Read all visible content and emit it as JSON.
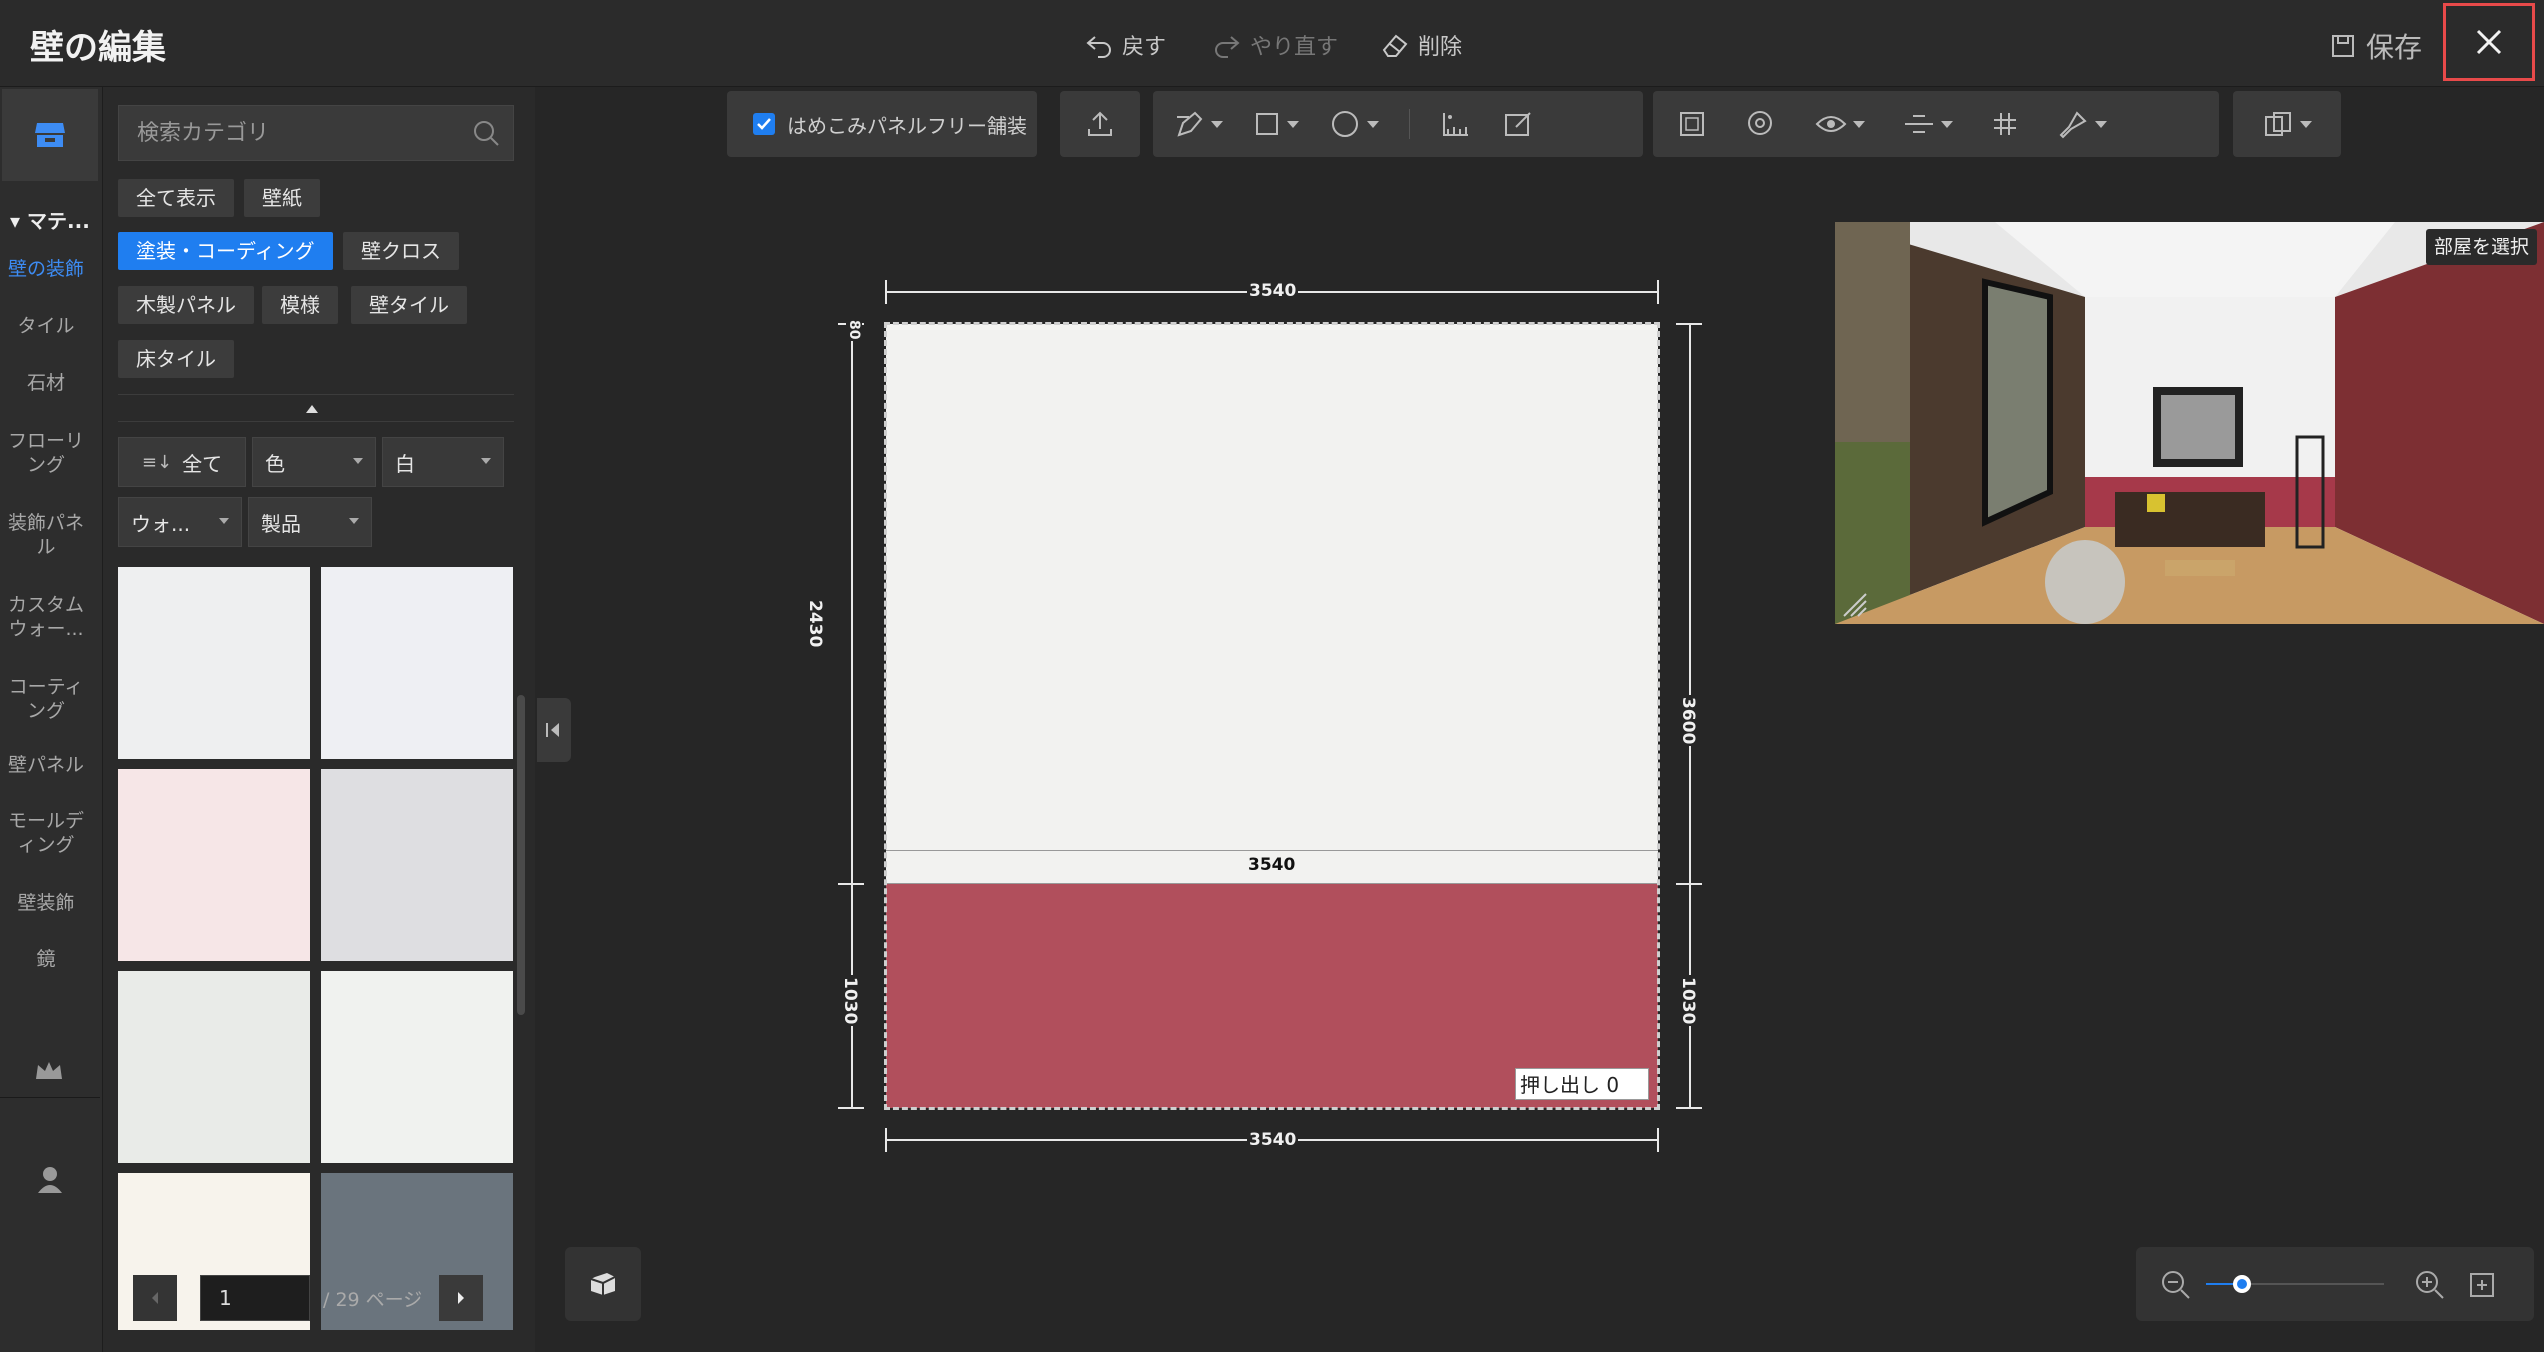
{
  "window": {
    "title": "壁の編集",
    "save_label": "保存"
  },
  "history": {
    "undo": "戻す",
    "redo": "やり直す",
    "delete": "削除"
  },
  "rail": {
    "heading": "マテ...",
    "items": [
      "壁の装飾",
      "タイル",
      "石材",
      "フローリング",
      "装飾パネル",
      "カスタムウォー...",
      "コーティング",
      "壁パネル",
      "モールディング",
      "壁装飾",
      "鏡"
    ]
  },
  "search": {
    "placeholder": "検索カテゴリ"
  },
  "categories": [
    "全て表示",
    "壁紙",
    "塗装・コーディング",
    "壁クロス",
    "木製パネル",
    "模様",
    "壁タイル",
    "床タイル"
  ],
  "filters": {
    "sort": "全て",
    "color_label": "色",
    "color_value": "白",
    "style": "ウォ...",
    "product": "製品"
  },
  "swatches": [
    "#eeeff0",
    "#eeeff3",
    "#f6e6e7",
    "#dedee1",
    "#e9ebe8",
    "#f0f2ef",
    "#f7f3ec",
    "#6a747d"
  ],
  "pager": {
    "current": "1",
    "total": "/ 29 ページ"
  },
  "toolbar": {
    "checkbox_label": "はめこみパネルフリー舗装",
    "checkbox_checked": true
  },
  "dimensions": {
    "top": "3540",
    "middle": "3540",
    "bottom": "3540",
    "left_upper": "2430",
    "left_lower": "1030",
    "right_total": "3600",
    "right_lower": "1030",
    "left_small": "80"
  },
  "extrude": {
    "label": "押し出し",
    "value": "0"
  },
  "preview": {
    "room_select": "部屋を選択"
  },
  "colors": {
    "accent": "#1f7ef0",
    "wall_upper": "#f2f2f0",
    "wall_lower": "#b14f5c",
    "highlight": "#e84a4a"
  },
  "zoom": {
    "level": 0.2
  }
}
